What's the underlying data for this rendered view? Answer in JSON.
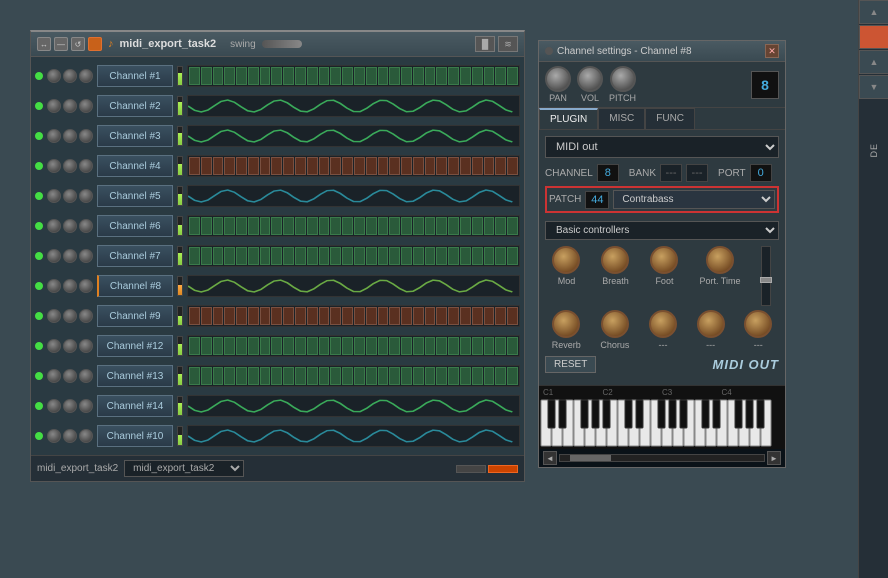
{
  "sequencer": {
    "title": "midi_export_task2",
    "swing_label": "swing",
    "channels": [
      {
        "label": "Channel #1",
        "active": false,
        "vol": 75,
        "pattern_type": "blocks"
      },
      {
        "label": "Channel #2",
        "active": false,
        "vol": 80,
        "pattern_type": "wave_green"
      },
      {
        "label": "Channel #3",
        "active": false,
        "vol": 72,
        "pattern_type": "wave_green"
      },
      {
        "label": "Channel #4",
        "active": false,
        "vol": 68,
        "pattern_type": "blocks_brown"
      },
      {
        "label": "Channel #5",
        "active": false,
        "vol": 70,
        "pattern_type": "wave_teal"
      },
      {
        "label": "Channel #6",
        "active": false,
        "vol": 65,
        "pattern_type": "blocks"
      },
      {
        "label": "Channel #7",
        "active": false,
        "vol": 74,
        "pattern_type": "blocks"
      },
      {
        "label": "Channel #8",
        "active": true,
        "vol": 60,
        "pattern_type": "wave_mixed"
      },
      {
        "label": "Channel #9",
        "active": false,
        "vol": 55,
        "pattern_type": "blocks_brown"
      },
      {
        "label": "Channel #12",
        "active": false,
        "vol": 70,
        "pattern_type": "blocks"
      },
      {
        "label": "Channel #13",
        "active": false,
        "vol": 68,
        "pattern_type": "blocks"
      },
      {
        "label": "Channel #14",
        "active": false,
        "vol": 72,
        "pattern_type": "wave_green"
      },
      {
        "label": "Channel #10",
        "active": false,
        "vol": 65,
        "pattern_type": "wave_teal"
      }
    ],
    "bottom_label": "midi_export_task2"
  },
  "channel_settings": {
    "title": "Channel settings - Channel #8",
    "number_display": "8",
    "tabs": [
      "PLUGIN",
      "MISC",
      "FUNC"
    ],
    "active_tab": "PLUGIN",
    "plugin_label": "MIDI out",
    "channel_label": "CHANNEL",
    "channel_value": "8",
    "bank_label": "BANK",
    "bank_dash1": "---",
    "bank_dash2": "---",
    "port_label": "PORT",
    "port_value": "0",
    "patch_label": "PATCH",
    "patch_value": "44",
    "patch_name": "Contrabass",
    "basic_controllers_label": "Basic controllers",
    "knob_labels": [
      "Mod",
      "Breath",
      "Foot",
      "Port. Time"
    ],
    "knob_labels2": [
      "Reverb",
      "Chorus",
      "---",
      "---",
      "---"
    ],
    "reset_label": "RESET",
    "midi_out_label": "MIDI OUT",
    "octave_labels": [
      "C1",
      "C2",
      "C3",
      "C4"
    ],
    "keyboard_nav_left": "◄",
    "keyboard_nav_right": "►"
  },
  "right_edge": {
    "buttons": [
      "▲",
      "▼",
      "▲",
      "▼"
    ],
    "de_label": "DE"
  }
}
